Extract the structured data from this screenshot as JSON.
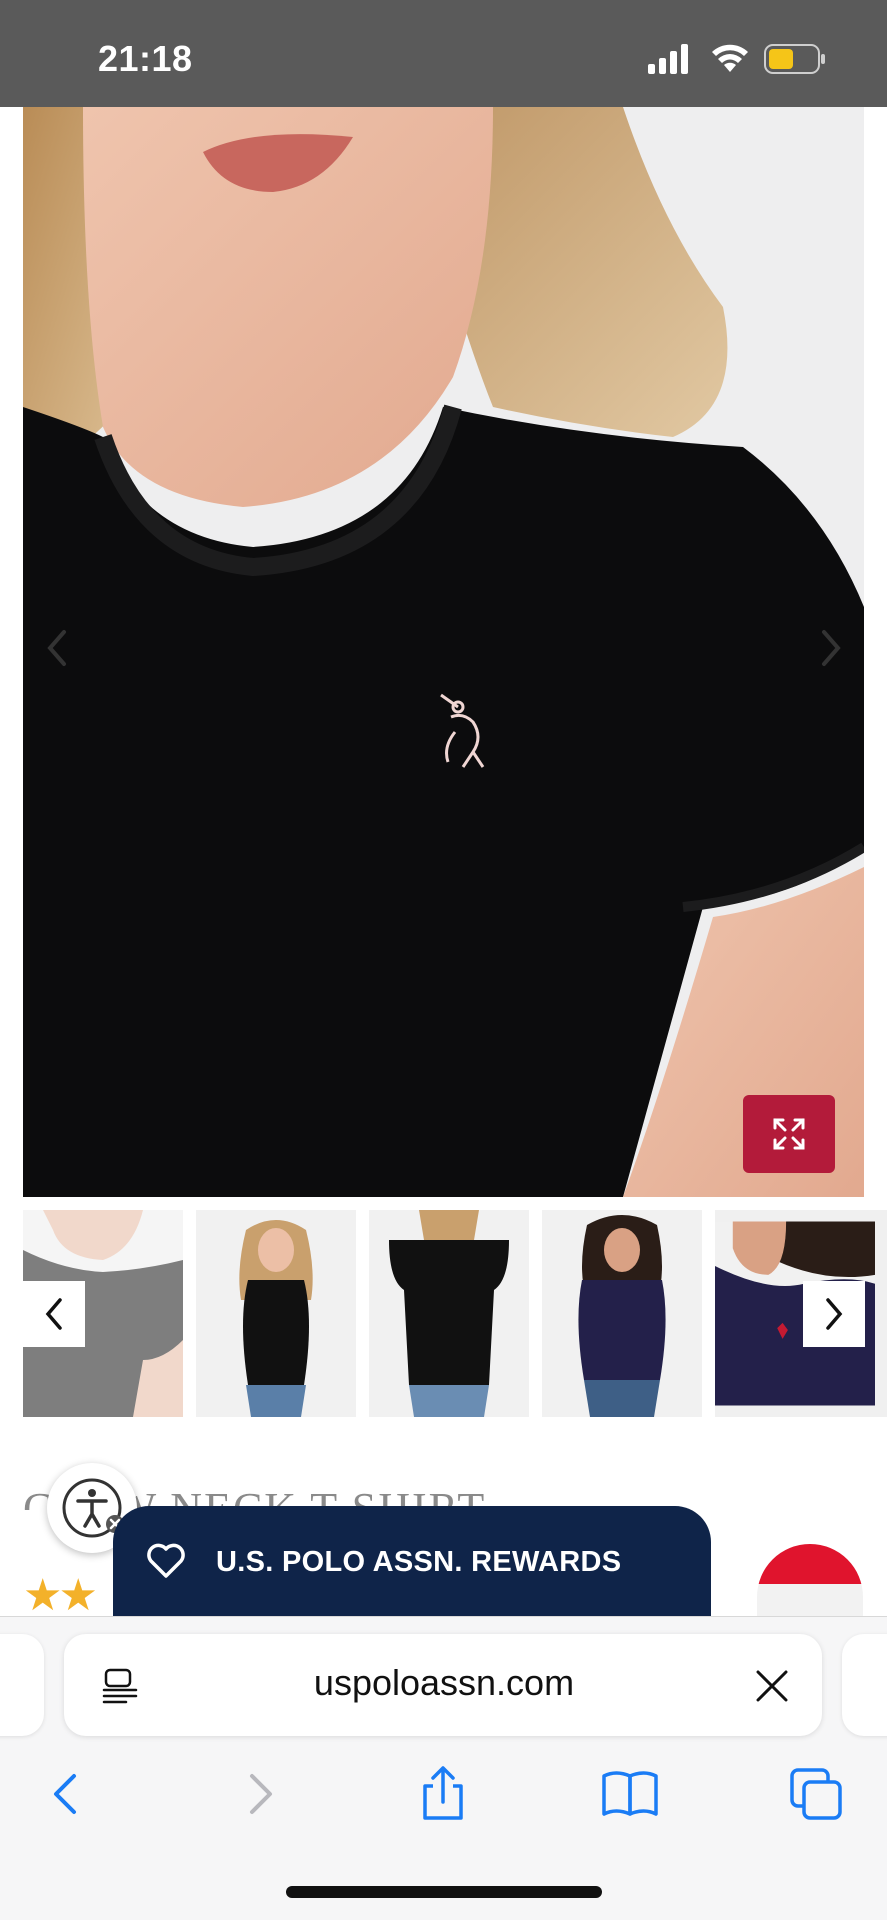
{
  "status_bar": {
    "time": "21:18",
    "icons": [
      "signal-icon",
      "wifi-icon",
      "battery-icon"
    ],
    "battery_color": "#f5c518"
  },
  "gallery": {
    "main_image": "black crew neck t-shirt worn by model, close-up with embroidered pink polo player logo",
    "prev_icon": "chevron-left-icon",
    "next_icon": "chevron-right-icon",
    "expand_icon": "expand-arrows-icon",
    "accent_color": "#b31b3a",
    "thumbnails": [
      {
        "name": "black tee close-up"
      },
      {
        "name": "black tee front full"
      },
      {
        "name": "black tee back"
      },
      {
        "name": "navy tee front full"
      },
      {
        "name": "navy tee close-up"
      }
    ]
  },
  "product": {
    "title": "CREW NECK T-SHIRT",
    "stars": "★★"
  },
  "rewards_banner": {
    "label": "U.S. POLO ASSN. REWARDS",
    "icon": "heart-icon",
    "background": "#0f2449"
  },
  "browser": {
    "url": "uspoloassn.com",
    "reader_icon": "reader-mode-icon",
    "clear_icon": "close-icon",
    "nav": [
      "back-icon",
      "forward-icon",
      "share-icon",
      "bookmarks-icon",
      "tabs-icon"
    ],
    "accent_color": "#1a7cf5"
  }
}
